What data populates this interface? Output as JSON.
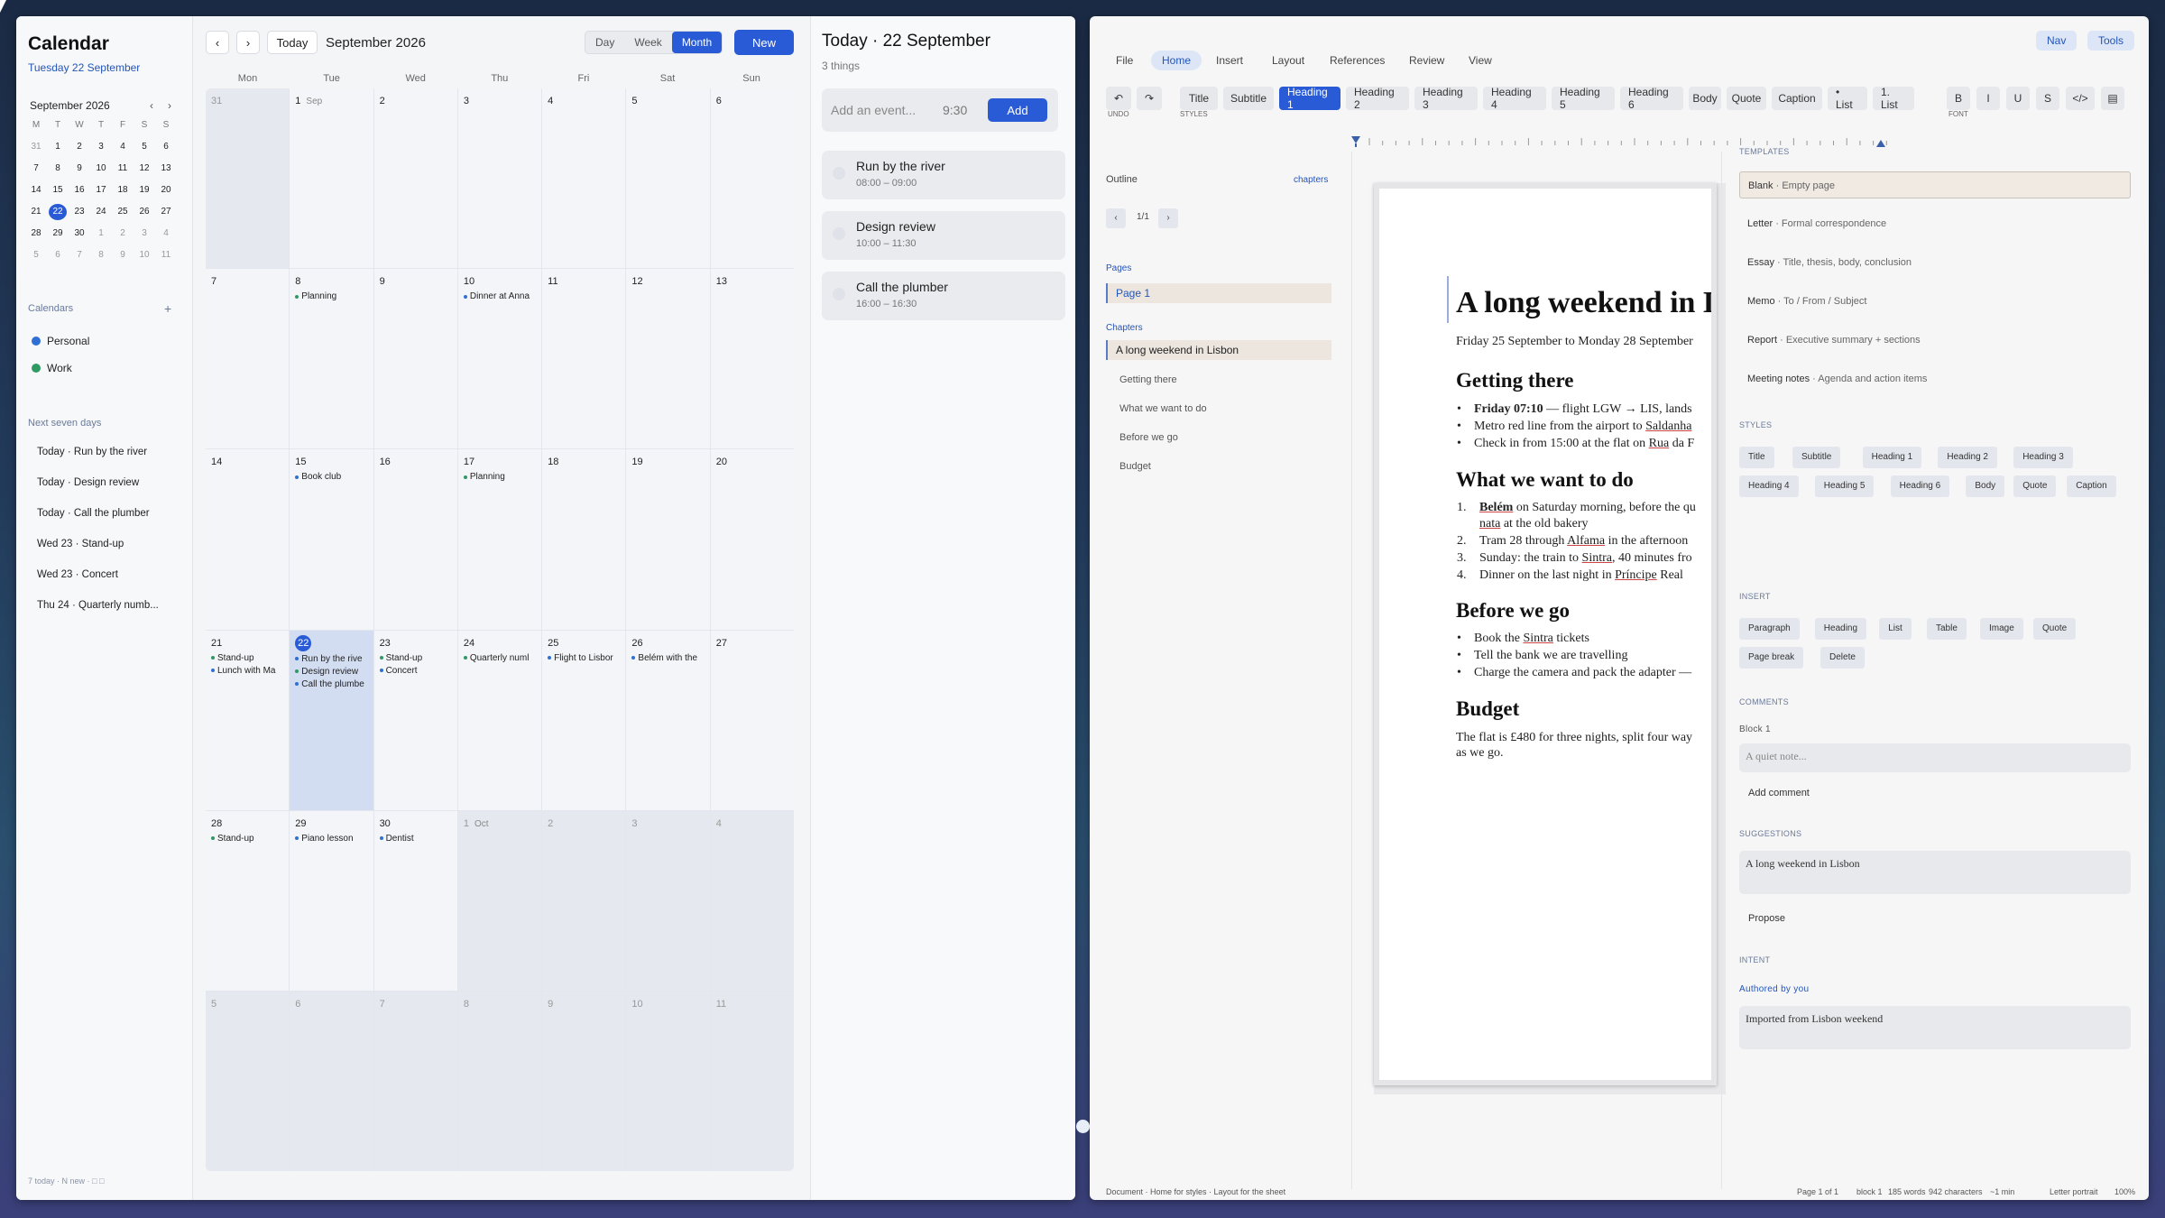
{
  "calendar": {
    "title": "Calendar",
    "date": "Tuesday 22 September",
    "mini": {
      "month": "September 2026",
      "prev": "‹",
      "next": "›",
      "weekdays": [
        "M",
        "T",
        "W",
        "T",
        "F",
        "S",
        "S"
      ],
      "days": [
        [
          "31",
          "1",
          "2",
          "3",
          "4",
          "5",
          "6"
        ],
        [
          "7",
          "8",
          "9",
          "10",
          "11",
          "12",
          "13"
        ],
        [
          "14",
          "15",
          "16",
          "17",
          "18",
          "19",
          "20"
        ],
        [
          "21",
          "22",
          "23",
          "24",
          "25",
          "26",
          "27"
        ],
        [
          "28",
          "29",
          "30",
          "1",
          "2",
          "3",
          "4"
        ],
        [
          "5",
          "6",
          "7",
          "8",
          "9",
          "10",
          "11"
        ]
      ],
      "selected": "22"
    },
    "calendars_label": "Calendars",
    "calendars_add": "+",
    "calendars": [
      {
        "name": "Personal",
        "color": "#2f6fd6"
      },
      {
        "name": "Work",
        "color": "#2e9a62"
      }
    ],
    "next_label": "Next seven days",
    "next": [
      "Today · Run by the river",
      "Today · Design review",
      "Today · Call the plumber",
      "Wed 23 · Stand-up",
      "Wed 23 · Concert",
      "Thu 24 · Quarterly numb..."
    ],
    "footer": "7 today · N new · □ □",
    "toolbar": {
      "prev": "‹",
      "next": "›",
      "today": "Today",
      "month": "September 2026",
      "views": [
        "Day",
        "Week",
        "Month"
      ],
      "active_view": "Month",
      "new": "New"
    },
    "weekdays": [
      "Mon",
      "Tue",
      "Wed",
      "Thu",
      "Fri",
      "Sat",
      "Sun"
    ],
    "weeks": [
      [
        {
          "n": "31",
          "out": true
        },
        {
          "n": "1",
          "m": "Sep"
        },
        {
          "n": "2"
        },
        {
          "n": "3"
        },
        {
          "n": "4"
        },
        {
          "n": "5"
        },
        {
          "n": "6"
        }
      ],
      [
        {
          "n": "7"
        },
        {
          "n": "8",
          "ev": [
            "Planning"
          ]
        },
        {
          "n": "9"
        },
        {
          "n": "10",
          "ev": [
            "Dinner at Anna"
          ]
        },
        {
          "n": "11"
        },
        {
          "n": "12"
        },
        {
          "n": "13"
        }
      ],
      [
        {
          "n": "14"
        },
        {
          "n": "15",
          "ev": [
            "Book club"
          ]
        },
        {
          "n": "16"
        },
        {
          "n": "17",
          "ev": [
            "Planning"
          ]
        },
        {
          "n": "18"
        },
        {
          "n": "19"
        },
        {
          "n": "20"
        }
      ],
      [
        {
          "n": "21",
          "ev": [
            "Stand-up",
            "Lunch with Ma"
          ]
        },
        {
          "n": "22",
          "today": true,
          "ev": [
            "Run by the rive",
            "Design review",
            "Call the plumbe"
          ]
        },
        {
          "n": "23",
          "ev": [
            "Stand-up",
            "Concert"
          ]
        },
        {
          "n": "24",
          "ev": [
            "Quarterly numl"
          ]
        },
        {
          "n": "25",
          "ev": [
            "Flight to Lisbor"
          ]
        },
        {
          "n": "26",
          "ev": [
            "Belém with the"
          ]
        },
        {
          "n": "27"
        }
      ],
      [
        {
          "n": "28",
          "ev": [
            "Stand-up"
          ]
        },
        {
          "n": "29",
          "ev": [
            "Piano lesson"
          ]
        },
        {
          "n": "30",
          "ev": [
            "Dentist"
          ]
        },
        {
          "n": "1",
          "m": "Oct",
          "out": true
        },
        {
          "n": "2",
          "out": true
        },
        {
          "n": "3",
          "out": true
        },
        {
          "n": "4",
          "out": true
        }
      ],
      [
        {
          "n": "5",
          "out": true
        },
        {
          "n": "6",
          "out": true
        },
        {
          "n": "7",
          "out": true
        },
        {
          "n": "8",
          "out": true
        },
        {
          "n": "9",
          "out": true
        },
        {
          "n": "10",
          "out": true
        },
        {
          "n": "11",
          "out": true
        }
      ]
    ],
    "day": {
      "title": "Today · 22 September",
      "count": "3 things",
      "add_placeholder": "Add an event...",
      "add_time": "9:30",
      "add_button": "Add",
      "events": [
        {
          "title": "Run by the river",
          "time": "08:00 – 09:00"
        },
        {
          "title": "Design review",
          "time": "10:00 – 11:30"
        },
        {
          "title": "Call the plumber",
          "time": "16:00 – 16:30"
        }
      ]
    }
  },
  "doc": {
    "menu": [
      "File",
      "Home",
      "Insert",
      "Layout",
      "References",
      "Review",
      "View"
    ],
    "active_menu": "Home",
    "top_right": [
      "Nav",
      "Tools"
    ],
    "undo": "↶",
    "redo": "↷",
    "undo_label": "UNDO",
    "styles_label": "STYLES",
    "font_label": "FONT",
    "styles": [
      "Title",
      "Subtitle",
      "Heading 1",
      "Heading 2",
      "Heading 3",
      "Heading 4",
      "Heading 5",
      "Heading 6",
      "Body",
      "Quote",
      "Caption",
      "• List",
      "1. List"
    ],
    "active_style": "Heading 1",
    "font": [
      "B",
      "I",
      "U",
      "S",
      "</>",
      "▤"
    ],
    "outline": {
      "title": "Outline",
      "chapters_link": "chapters",
      "page": "1/1",
      "prev": "‹",
      "next": "›",
      "pages_label": "Pages",
      "pages": [
        "Page 1"
      ],
      "chapters_label": "Chapters",
      "chapters": [
        "A long weekend in Lisbon",
        "Getting there",
        "What we want to do",
        "Before we go",
        "Budget"
      ]
    },
    "page": {
      "title": "A long weekend in Lisbon",
      "subtitle": "Friday 25 September to Monday 28 September",
      "h_getting": "Getting there",
      "getting": [
        "Friday 07:10 — flight LGW → LIS, lands",
        "Metro red line from the airport to Saldanha",
        "Check in from 15:00 at the flat on Rua da F"
      ],
      "h_want": "What we want to do",
      "want": [
        "Belém on Saturday morning, before the qu",
        "nata at the old bakery",
        "Tram 28 through Alfama in the afternoon",
        "Sunday: the train to Sintra, 40 minutes fro",
        "Dinner on the last night in Príncipe Real"
      ],
      "h_before": "Before we go",
      "before": [
        "Book the Sintra tickets",
        "Tell the bank we are travelling",
        "Charge the camera and pack the adapter —"
      ],
      "h_budget": "Budget",
      "budget": [
        "The flat is £480 for three nights, split four way",
        "as we go."
      ]
    },
    "templates_label": "TEMPLATES",
    "templates": [
      {
        "name": "Blank",
        "desc": "Empty page"
      },
      {
        "name": "Letter",
        "desc": "Formal correspondence"
      },
      {
        "name": "Essay",
        "desc": "Title, thesis, body, conclusion"
      },
      {
        "name": "Memo",
        "desc": "To / From / Subject"
      },
      {
        "name": "Report",
        "desc": "Executive summary + sections"
      },
      {
        "name": "Meeting notes",
        "desc": "Agenda and action items"
      }
    ],
    "styles_panel_label": "STYLES",
    "styles_panel": [
      "Title",
      "Subtitle",
      "Heading 1",
      "Heading 2",
      "Heading 3",
      "Heading 4",
      "Heading 5",
      "Heading 6",
      "Body",
      "Quote",
      "Caption"
    ],
    "insert_label": "INSERT",
    "insert": [
      "Paragraph",
      "Heading",
      "List",
      "Table",
      "Image",
      "Quote",
      "Page break",
      "Delete"
    ],
    "comments_label": "COMMENTS",
    "comment_block": "Block 1",
    "comment_placeholder": "A quiet note...",
    "add_comment": "Add comment",
    "suggestions_label": "SUGGESTIONS",
    "suggestion": "A long weekend in Lisbon",
    "propose": "Propose",
    "intent_label": "INTENT",
    "intent_author": "Authored by you",
    "intent": "Imported from Lisbon weekend",
    "status_left": "Document · Home for styles · Layout for the sheet",
    "status_right": [
      "Page 1 of 1",
      "block 1",
      "185 words",
      "942 characters",
      "~1 min",
      "Letter portrait",
      "100%"
    ]
  }
}
